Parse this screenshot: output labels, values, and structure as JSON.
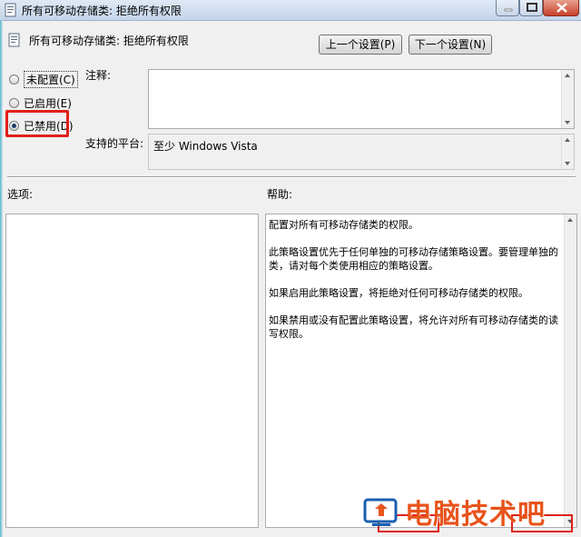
{
  "window": {
    "title": "所有可移动存储类: 拒绝所有权限",
    "icons": {
      "app": "policy-icon",
      "minimize": "minimize-icon",
      "maximize": "maximize-icon",
      "close": "close-icon"
    }
  },
  "header": {
    "title": "所有可移动存储类: 拒绝所有权限",
    "prev_label": "上一个设置(P)",
    "next_label": "下一个设置(N)"
  },
  "state": {
    "options": [
      {
        "label": "未配置(C)",
        "checked": false
      },
      {
        "label": "已启用(E)",
        "checked": false
      },
      {
        "label": "已禁用(D)",
        "checked": true
      }
    ],
    "highlight_color": "#e0201a"
  },
  "fields": {
    "comment_label": "注释:",
    "comment_value": "",
    "platform_label": "支持的平台:",
    "platform_value": "至少 Windows Vista"
  },
  "panes": {
    "options_label": "选项:",
    "help_label": "帮助:",
    "help_paragraphs": [
      "配置对所有可移动存储类的权限。",
      "此策略设置优先于任何单独的可移动存储策略设置。要管理单独的类，请对每个类使用相应的策略设置。",
      "如果启用此策略设置，将拒绝对任何可移动存储类的权限。",
      "如果禁用或没有配置此策略设置，将允许对所有可移动存储类的读写权限。"
    ]
  },
  "watermark": {
    "text": "电脑技术吧",
    "color": "#e8541c"
  }
}
